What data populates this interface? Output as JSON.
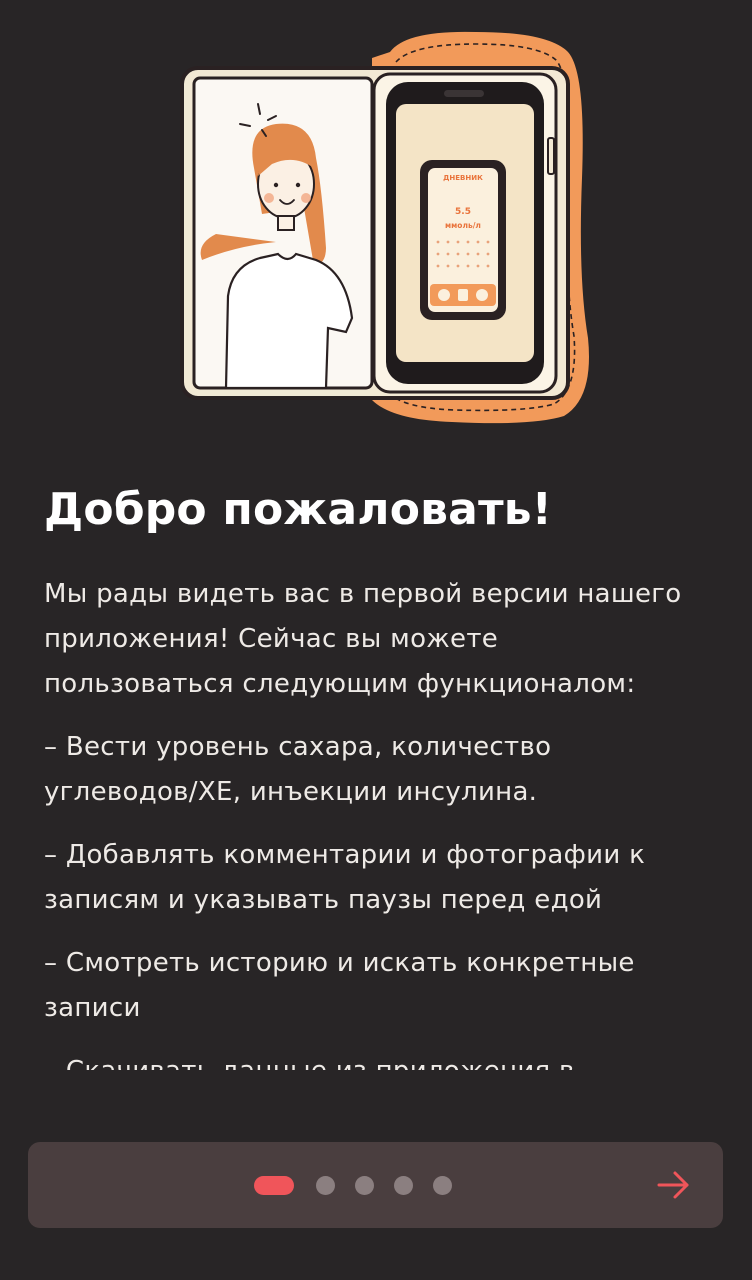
{
  "welcome": {
    "title": "Добро пожаловать!",
    "intro_lines": [
      "Мы рады видеть вас в первой версии нашего",
      "приложения! Сейчас вы можете",
      "пользоваться следующим функционалом:"
    ],
    "features": [
      {
        "lines": [
          "– Вести уровень сахара, количество",
          "углеводов/ХЕ, инъекции инсулина."
        ]
      },
      {
        "lines": [
          "– Добавлять комментарии и фотографии к",
          "записям и указывать паузы перед едой"
        ]
      },
      {
        "lines": [
          "– Смотреть историю и искать конкретные",
          "записи"
        ]
      },
      {
        "lines": [
          "– Скачивать данные из приложения в",
          ""
        ]
      }
    ]
  },
  "illustration": {
    "phone_screen": {
      "header": "ДНЕВНИК",
      "value": "5.5",
      "unit": "ммоль/л"
    }
  },
  "pager": {
    "total_pages": 5,
    "current_page": 1,
    "next_icon": "arrow-right-icon"
  },
  "colors": {
    "background": "#282526",
    "accent": "#f0555a",
    "illustration_orange": "#f29a5a",
    "bottom_bar": "#4a3e3f"
  }
}
